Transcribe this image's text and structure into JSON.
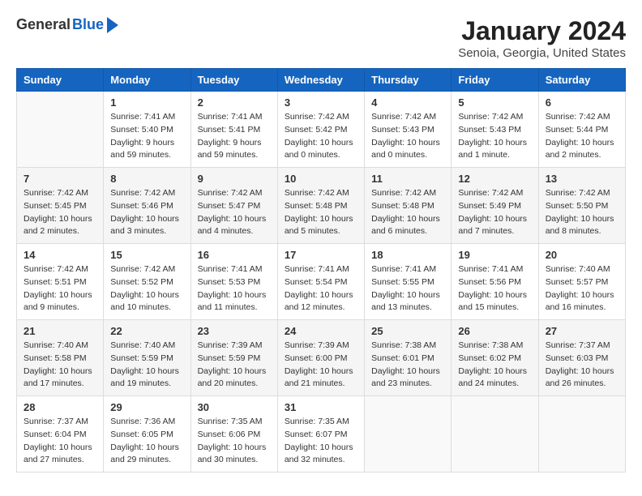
{
  "header": {
    "logo_general": "General",
    "logo_blue": "Blue",
    "title": "January 2024",
    "subtitle": "Senoia, Georgia, United States"
  },
  "calendar": {
    "headers": [
      "Sunday",
      "Monday",
      "Tuesday",
      "Wednesday",
      "Thursday",
      "Friday",
      "Saturday"
    ],
    "weeks": [
      [
        {
          "day": "",
          "info": ""
        },
        {
          "day": "1",
          "info": "Sunrise: 7:41 AM\nSunset: 5:40 PM\nDaylight: 9 hours\nand 59 minutes."
        },
        {
          "day": "2",
          "info": "Sunrise: 7:41 AM\nSunset: 5:41 PM\nDaylight: 9 hours\nand 59 minutes."
        },
        {
          "day": "3",
          "info": "Sunrise: 7:42 AM\nSunset: 5:42 PM\nDaylight: 10 hours\nand 0 minutes."
        },
        {
          "day": "4",
          "info": "Sunrise: 7:42 AM\nSunset: 5:43 PM\nDaylight: 10 hours\nand 0 minutes."
        },
        {
          "day": "5",
          "info": "Sunrise: 7:42 AM\nSunset: 5:43 PM\nDaylight: 10 hours\nand 1 minute."
        },
        {
          "day": "6",
          "info": "Sunrise: 7:42 AM\nSunset: 5:44 PM\nDaylight: 10 hours\nand 2 minutes."
        }
      ],
      [
        {
          "day": "7",
          "info": "Sunrise: 7:42 AM\nSunset: 5:45 PM\nDaylight: 10 hours\nand 2 minutes."
        },
        {
          "day": "8",
          "info": "Sunrise: 7:42 AM\nSunset: 5:46 PM\nDaylight: 10 hours\nand 3 minutes."
        },
        {
          "day": "9",
          "info": "Sunrise: 7:42 AM\nSunset: 5:47 PM\nDaylight: 10 hours\nand 4 minutes."
        },
        {
          "day": "10",
          "info": "Sunrise: 7:42 AM\nSunset: 5:48 PM\nDaylight: 10 hours\nand 5 minutes."
        },
        {
          "day": "11",
          "info": "Sunrise: 7:42 AM\nSunset: 5:48 PM\nDaylight: 10 hours\nand 6 minutes."
        },
        {
          "day": "12",
          "info": "Sunrise: 7:42 AM\nSunset: 5:49 PM\nDaylight: 10 hours\nand 7 minutes."
        },
        {
          "day": "13",
          "info": "Sunrise: 7:42 AM\nSunset: 5:50 PM\nDaylight: 10 hours\nand 8 minutes."
        }
      ],
      [
        {
          "day": "14",
          "info": "Sunrise: 7:42 AM\nSunset: 5:51 PM\nDaylight: 10 hours\nand 9 minutes."
        },
        {
          "day": "15",
          "info": "Sunrise: 7:42 AM\nSunset: 5:52 PM\nDaylight: 10 hours\nand 10 minutes."
        },
        {
          "day": "16",
          "info": "Sunrise: 7:41 AM\nSunset: 5:53 PM\nDaylight: 10 hours\nand 11 minutes."
        },
        {
          "day": "17",
          "info": "Sunrise: 7:41 AM\nSunset: 5:54 PM\nDaylight: 10 hours\nand 12 minutes."
        },
        {
          "day": "18",
          "info": "Sunrise: 7:41 AM\nSunset: 5:55 PM\nDaylight: 10 hours\nand 13 minutes."
        },
        {
          "day": "19",
          "info": "Sunrise: 7:41 AM\nSunset: 5:56 PM\nDaylight: 10 hours\nand 15 minutes."
        },
        {
          "day": "20",
          "info": "Sunrise: 7:40 AM\nSunset: 5:57 PM\nDaylight: 10 hours\nand 16 minutes."
        }
      ],
      [
        {
          "day": "21",
          "info": "Sunrise: 7:40 AM\nSunset: 5:58 PM\nDaylight: 10 hours\nand 17 minutes."
        },
        {
          "day": "22",
          "info": "Sunrise: 7:40 AM\nSunset: 5:59 PM\nDaylight: 10 hours\nand 19 minutes."
        },
        {
          "day": "23",
          "info": "Sunrise: 7:39 AM\nSunset: 5:59 PM\nDaylight: 10 hours\nand 20 minutes."
        },
        {
          "day": "24",
          "info": "Sunrise: 7:39 AM\nSunset: 6:00 PM\nDaylight: 10 hours\nand 21 minutes."
        },
        {
          "day": "25",
          "info": "Sunrise: 7:38 AM\nSunset: 6:01 PM\nDaylight: 10 hours\nand 23 minutes."
        },
        {
          "day": "26",
          "info": "Sunrise: 7:38 AM\nSunset: 6:02 PM\nDaylight: 10 hours\nand 24 minutes."
        },
        {
          "day": "27",
          "info": "Sunrise: 7:37 AM\nSunset: 6:03 PM\nDaylight: 10 hours\nand 26 minutes."
        }
      ],
      [
        {
          "day": "28",
          "info": "Sunrise: 7:37 AM\nSunset: 6:04 PM\nDaylight: 10 hours\nand 27 minutes."
        },
        {
          "day": "29",
          "info": "Sunrise: 7:36 AM\nSunset: 6:05 PM\nDaylight: 10 hours\nand 29 minutes."
        },
        {
          "day": "30",
          "info": "Sunrise: 7:35 AM\nSunset: 6:06 PM\nDaylight: 10 hours\nand 30 minutes."
        },
        {
          "day": "31",
          "info": "Sunrise: 7:35 AM\nSunset: 6:07 PM\nDaylight: 10 hours\nand 32 minutes."
        },
        {
          "day": "",
          "info": ""
        },
        {
          "day": "",
          "info": ""
        },
        {
          "day": "",
          "info": ""
        }
      ]
    ]
  }
}
